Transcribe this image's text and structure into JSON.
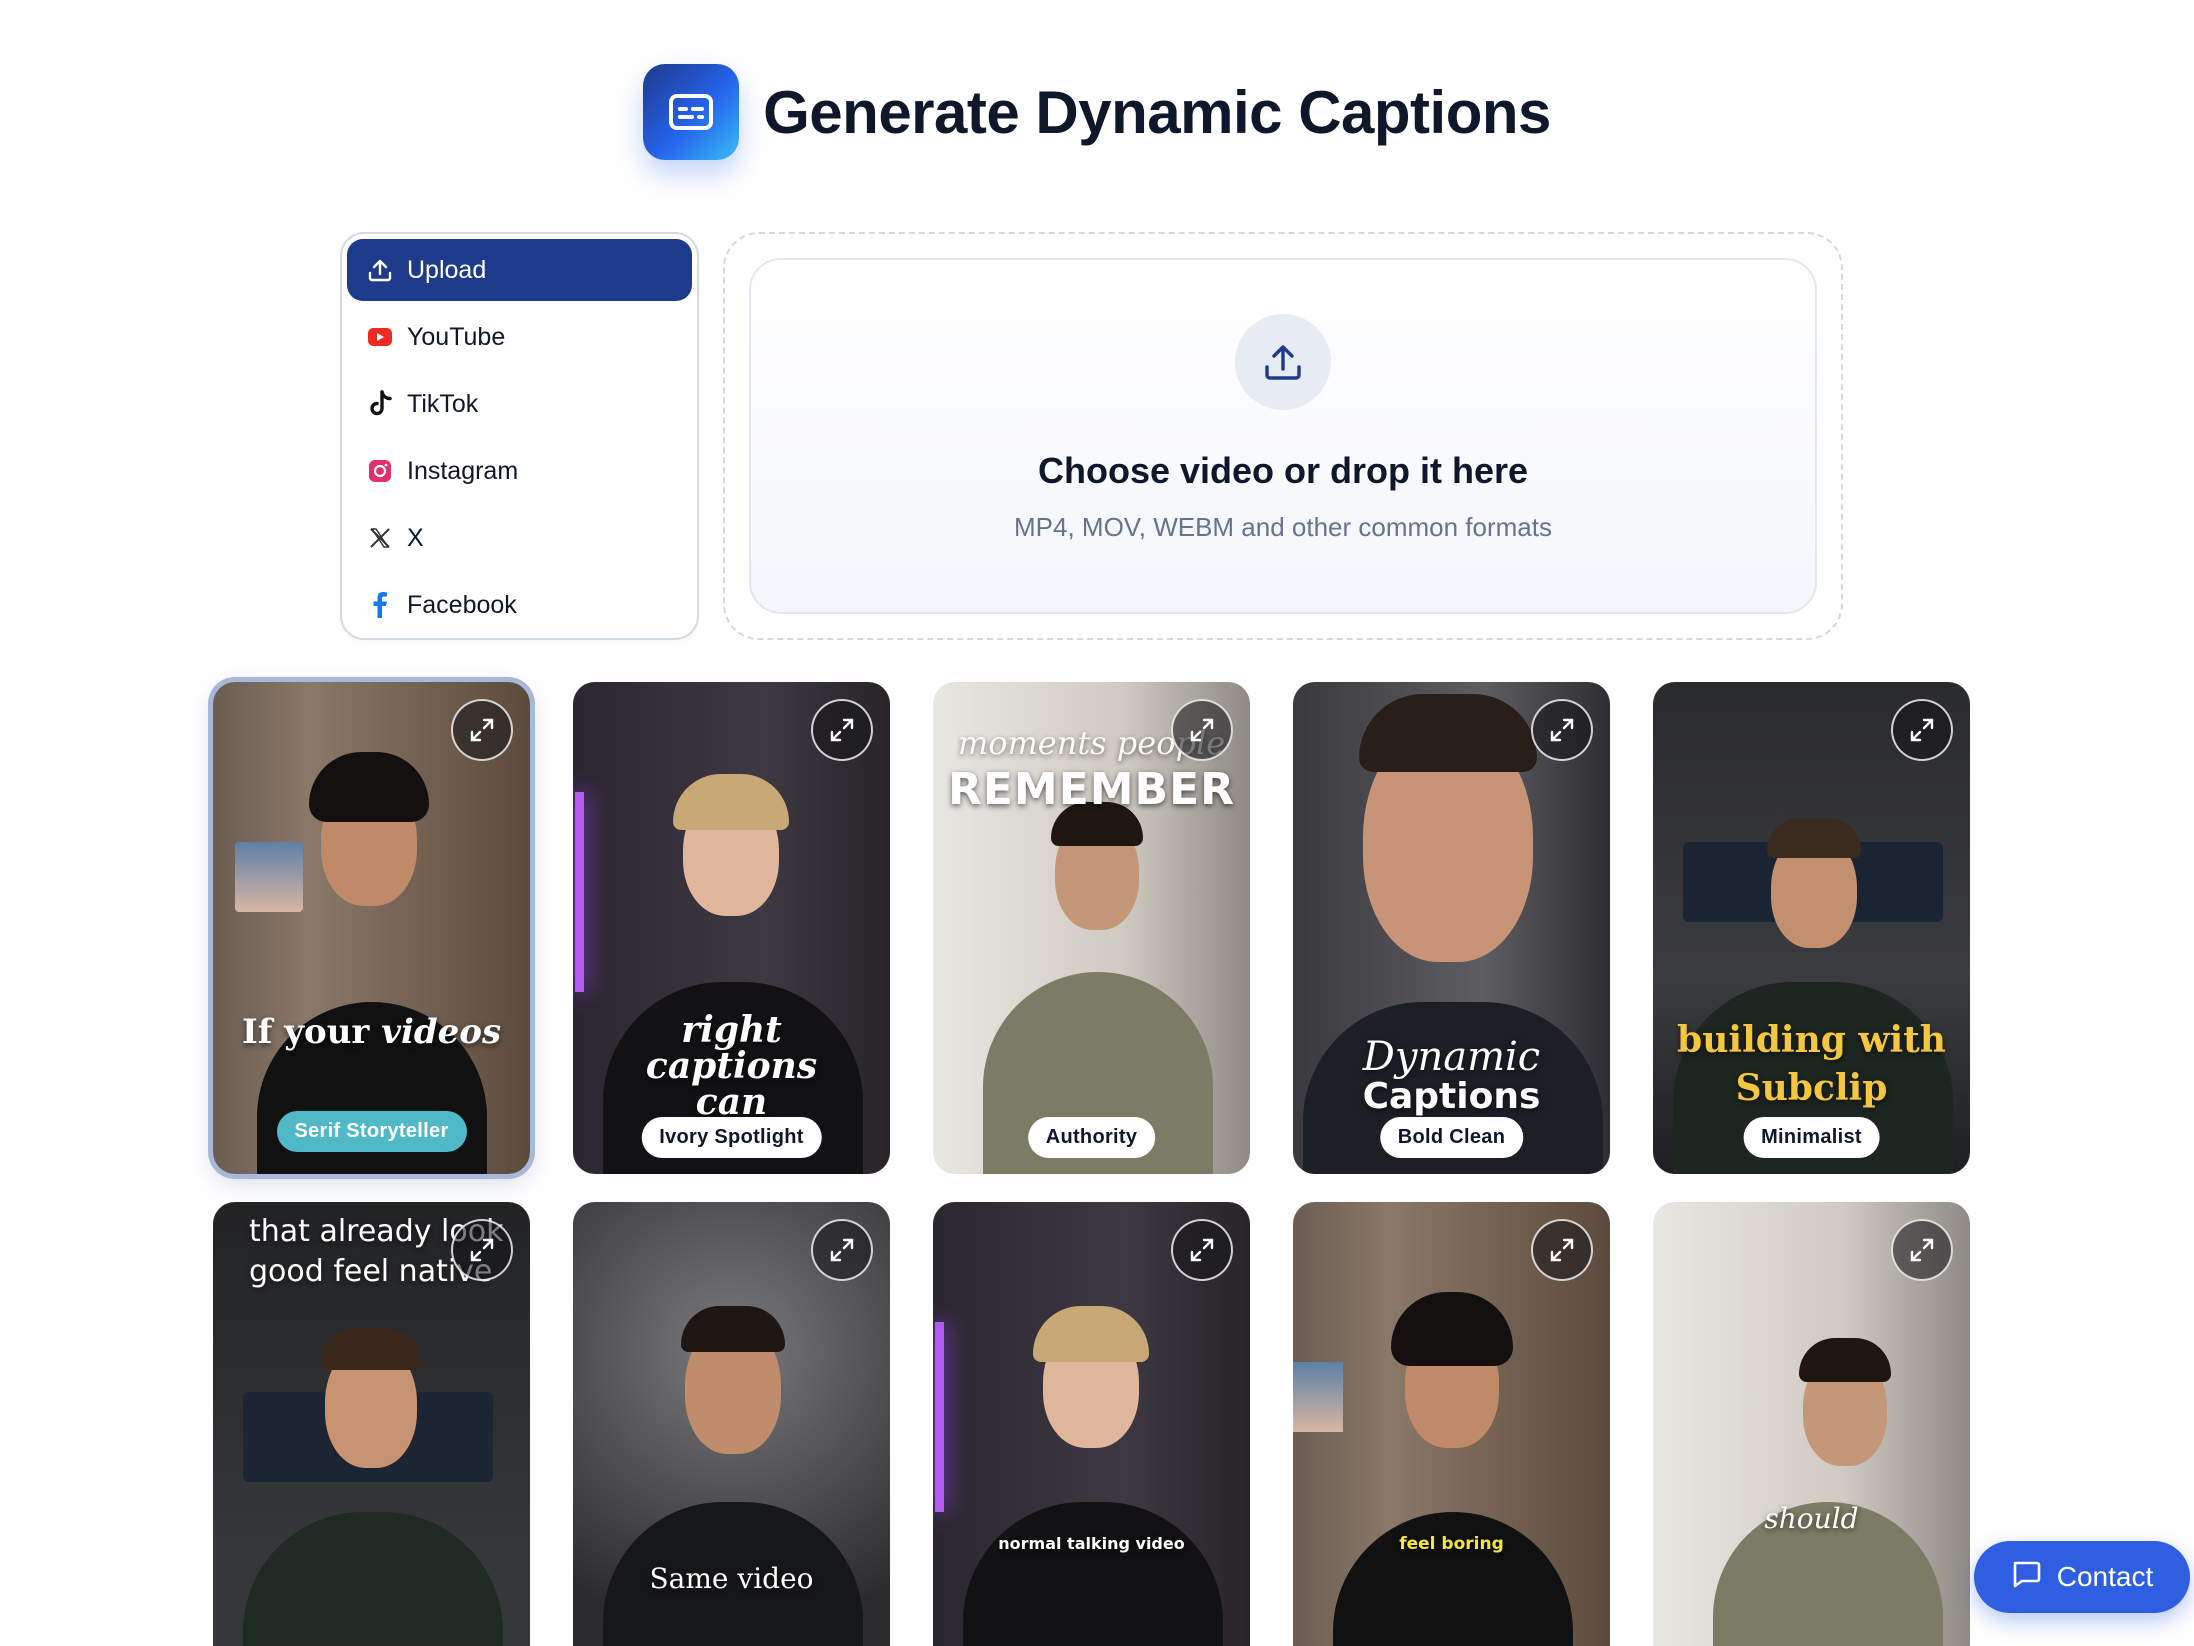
{
  "header": {
    "title": "Generate Dynamic Captions",
    "logo_icon": "captions-icon"
  },
  "sources": [
    {
      "label": "Upload",
      "icon": "upload-icon",
      "active": true
    },
    {
      "label": "YouTube",
      "icon": "youtube-icon",
      "active": false
    },
    {
      "label": "TikTok",
      "icon": "tiktok-icon",
      "active": false
    },
    {
      "label": "Instagram",
      "icon": "instagram-icon",
      "active": false
    },
    {
      "label": "X",
      "icon": "x-icon",
      "active": false
    },
    {
      "label": "Facebook",
      "icon": "facebook-icon",
      "active": false
    }
  ],
  "dropzone": {
    "title": "Choose video or drop it here",
    "subtitle": "MP4, MOV, WEBM and other common formats",
    "icon": "upload-icon"
  },
  "styles": [
    {
      "name": "Serif Storyteller",
      "caption_a": "If your",
      "caption_b": "videos",
      "selected": true
    },
    {
      "name": "Ivory Spotlight",
      "caption_a": "right",
      "caption_b": "captions",
      "caption_c": "can"
    },
    {
      "name": "Authority",
      "caption_a": "moments people",
      "caption_b": "REMEMBER"
    },
    {
      "name": "Bold Clean",
      "caption_a": "Dynamic",
      "caption_b": "Captions"
    },
    {
      "name": "Minimalist",
      "caption_a": "building with",
      "caption_b": "Subclip"
    },
    {
      "name": "",
      "caption_a": "that already look",
      "caption_b": "good feel native"
    },
    {
      "name": "",
      "caption_a": "Same video"
    },
    {
      "name": "",
      "caption_a": "normal talking video"
    },
    {
      "name": "",
      "caption_a": "feel boring"
    },
    {
      "name": "",
      "caption_a": "should"
    }
  ],
  "contact": {
    "label": "Contact",
    "icon": "chat-icon"
  },
  "colors": {
    "primary": "#1e3a8a",
    "accent": "#2f5fe0",
    "selected_pill": "#4fb9c7"
  }
}
